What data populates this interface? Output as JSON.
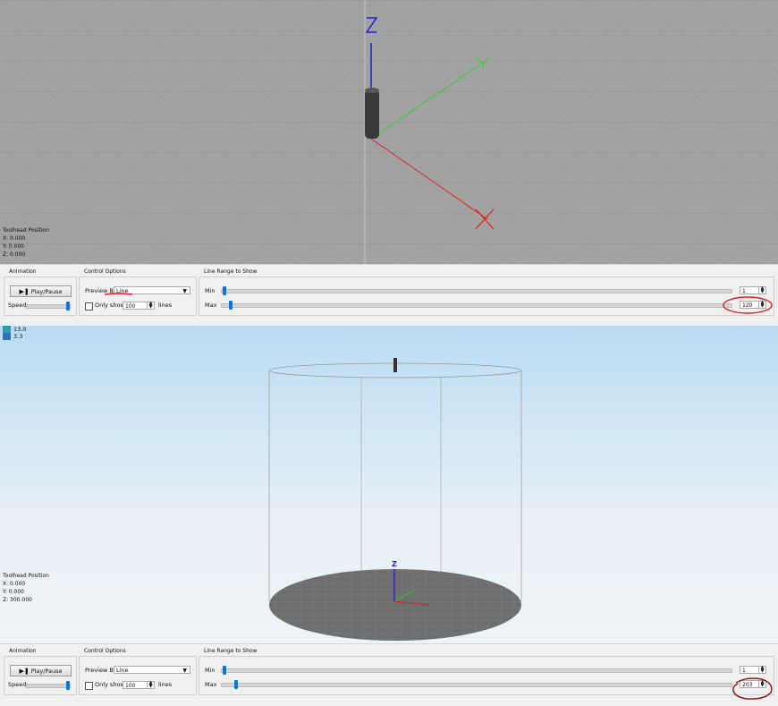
{
  "top": {
    "toolhead": {
      "title": "Toolhead Position",
      "x": "X: 0.000",
      "y": "Y: 0.000",
      "z": "Z: 0.000"
    },
    "axes": {
      "x": "x-axis",
      "y": "y-axis",
      "z": "z-axis"
    },
    "panel": {
      "animation": {
        "title": "Animation",
        "play_pause": "Play/Pause",
        "speed_label": "Speed:",
        "speed_fraction": 0.95
      },
      "control": {
        "title": "Control Options",
        "preview_by_label": "Preview By",
        "preview_by_value": "Line",
        "only_show_label": "Only show",
        "only_show_value": "100",
        "lines_label": "lines"
      },
      "range": {
        "title": "Line Range to Show",
        "min_label": "Min",
        "max_label": "Max",
        "min_value": "1",
        "max_value": "120"
      }
    }
  },
  "bottom": {
    "legend": [
      {
        "value": "13.0",
        "color": "#2a9bb0"
      },
      {
        "value": "3.3",
        "color": "#2b72c2"
      }
    ],
    "toolhead": {
      "title": "Toolhead Position",
      "x": "X: 0.000",
      "y": "Y: 0.000",
      "z": "Z: 300.000"
    },
    "axis_z_label": "Z",
    "panel": {
      "animation": {
        "title": "Animation",
        "play_pause": "Play/Pause",
        "speed_label": "Speed:",
        "speed_fraction": 0.95
      },
      "control": {
        "title": "Control Options",
        "preview_by_label": "Preview By",
        "preview_by_value": "Line",
        "only_show_label": "Only show",
        "only_show_value": "100",
        "lines_label": "lines"
      },
      "range": {
        "title": "Line Range to Show",
        "min_label": "Min",
        "max_label": "Max",
        "min_value": "1",
        "max_value": "203"
      }
    }
  },
  "colors": {
    "annotation_top": "#e0201e",
    "annotation_bottom": "#8a1010",
    "slider_handle": "#0a78d7"
  }
}
